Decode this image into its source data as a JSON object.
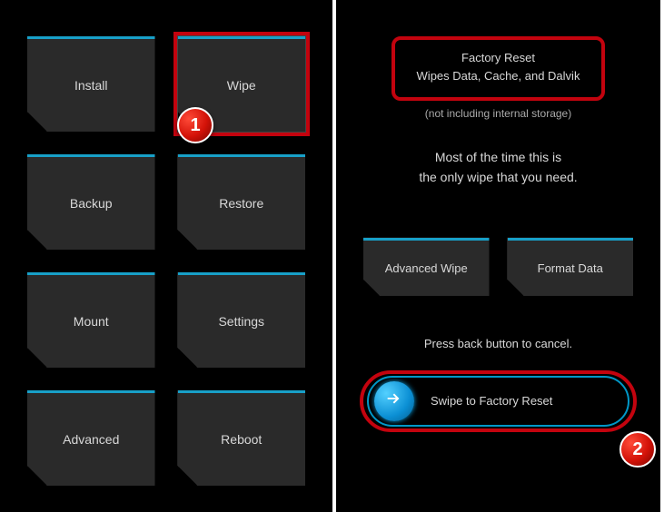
{
  "left": {
    "tiles": [
      {
        "label": "Install"
      },
      {
        "label": "Wipe",
        "highlight": true
      },
      {
        "label": "Backup"
      },
      {
        "label": "Restore"
      },
      {
        "label": "Mount"
      },
      {
        "label": "Settings"
      },
      {
        "label": "Advanced"
      },
      {
        "label": "Reboot"
      }
    ]
  },
  "right": {
    "header": {
      "title": "Factory Reset",
      "subtitle": "Wipes Data, Cache, and Dalvik"
    },
    "header_note": "(not including internal storage)",
    "info_line1": "Most of the time this is",
    "info_line2": "the only wipe that you need.",
    "buttons": [
      {
        "label": "Advanced Wipe"
      },
      {
        "label": "Format Data"
      }
    ],
    "back_note": "Press back button to cancel.",
    "slider_label": "Swipe to Factory Reset"
  },
  "badges": {
    "one": "1",
    "two": "2"
  }
}
